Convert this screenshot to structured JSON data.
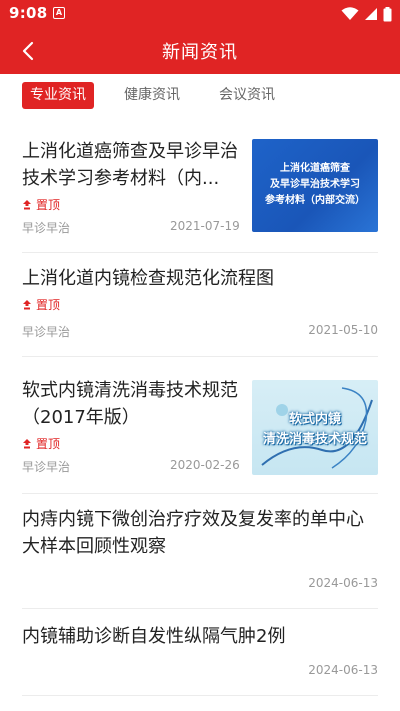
{
  "status": {
    "time": "9:08",
    "badge": "A"
  },
  "header": {
    "title": "新闻资讯"
  },
  "tabs": [
    {
      "label": "专业资讯",
      "active": true
    },
    {
      "label": "健康资讯",
      "active": false
    },
    {
      "label": "会议资讯",
      "active": false
    }
  ],
  "pin_label": "置顶",
  "colors": {
    "primary": "#e02424",
    "meta": "#999999",
    "text": "#222222"
  },
  "articles": [
    {
      "title": "上消化道癌筛查及早诊早治技术学习参考材料（内...",
      "pinned": true,
      "source": "早诊早治",
      "date": "2021-07-19",
      "thumb_lines": [
        "上消化道癌筛查",
        "及早诊早治技术学习",
        "参考材料（内部交流）"
      ]
    },
    {
      "title": "上消化道内镜检查规范化流程图",
      "pinned": true,
      "source": "早诊早治",
      "date": "2021-05-10"
    },
    {
      "title": "软式内镜清洗消毒技术规范（2017年版）",
      "pinned": true,
      "source": "早诊早治",
      "date": "2020-02-26",
      "thumb_lines": [
        "软式内镜",
        "清洗消毒技术规范"
      ]
    },
    {
      "title": "内痔内镜下微创治疗疗效及复发率的单中心大样本回顾性观察",
      "pinned": false,
      "date": "2024-06-13"
    },
    {
      "title": "内镜辅助诊断自发性纵隔气肿2例",
      "pinned": false,
      "date": "2024-06-13"
    }
  ]
}
